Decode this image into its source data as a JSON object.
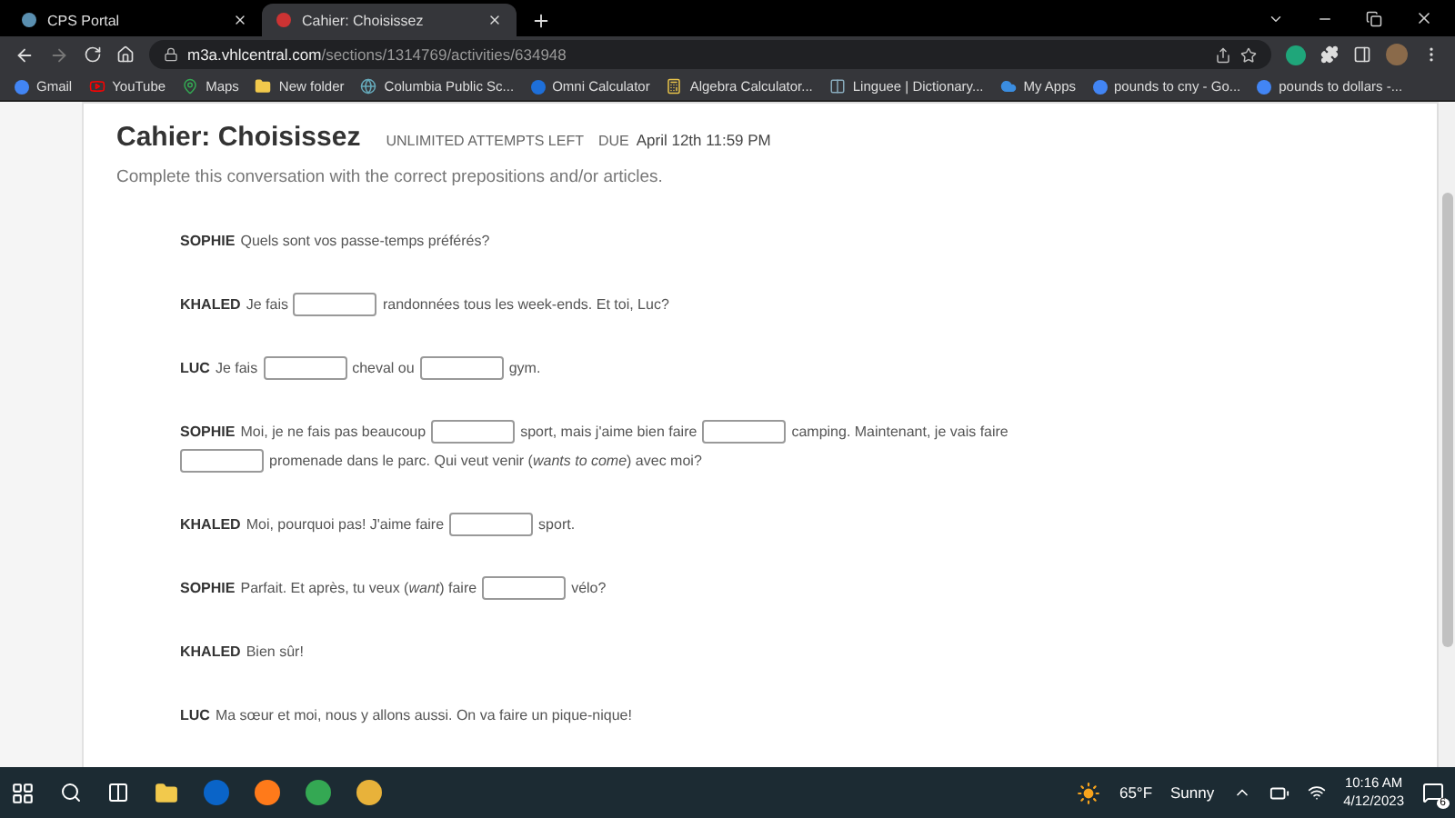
{
  "browser": {
    "tabs": [
      {
        "title": "CPS Portal",
        "selected": false
      },
      {
        "title": "Cahier: Choisissez",
        "selected": true
      }
    ],
    "url": {
      "host": "m3a.vhlcentral.com",
      "path": "/sections/1314769/activities/634948"
    },
    "bookmarks": [
      {
        "label": "Gmail",
        "kind": "google"
      },
      {
        "label": "YouTube",
        "kind": "youtube"
      },
      {
        "label": "Maps",
        "kind": "maps"
      },
      {
        "label": "New folder",
        "kind": "folder"
      },
      {
        "label": "Columbia Public Sc...",
        "kind": "globe"
      },
      {
        "label": "Omni Calculator",
        "kind": "omni"
      },
      {
        "label": "Algebra Calculator...",
        "kind": "calc"
      },
      {
        "label": "Linguee | Dictionary...",
        "kind": "linguee"
      },
      {
        "label": "My Apps",
        "kind": "cloud"
      },
      {
        "label": "pounds to cny - Go...",
        "kind": "google"
      },
      {
        "label": "pounds to dollars -...",
        "kind": "google"
      }
    ]
  },
  "activity": {
    "title": "Cahier: Choisissez",
    "attempts": "UNLIMITED ATTEMPTS LEFT",
    "due_label": "DUE",
    "due": "April 12th 11:59 PM",
    "instructions": "Complete this conversation with the correct prepositions and/or articles.",
    "lines": [
      {
        "speaker": "SOPHIE",
        "parts": [
          {
            "kind": "text",
            "text": "Quels sont vos passe-temps préférés?"
          }
        ]
      },
      {
        "speaker": "KHALED",
        "parts": [
          {
            "kind": "text",
            "text": "Je fais"
          },
          {
            "kind": "blank"
          },
          {
            "kind": "text",
            "text": "randonnées tous les week-ends. Et toi, Luc?"
          }
        ]
      },
      {
        "speaker": "LUC",
        "parts": [
          {
            "kind": "text",
            "text": "Je fais"
          },
          {
            "kind": "blank"
          },
          {
            "kind": "text",
            "text": "cheval ou"
          },
          {
            "kind": "blank"
          },
          {
            "kind": "text",
            "text": "gym."
          }
        ]
      },
      {
        "speaker": "SOPHIE",
        "parts": [
          {
            "kind": "text",
            "text": "Moi, je ne fais pas beaucoup"
          },
          {
            "kind": "blank"
          },
          {
            "kind": "text",
            "text": "sport, mais j'aime bien faire"
          },
          {
            "kind": "blank"
          },
          {
            "kind": "text",
            "text": "camping. Maintenant, je vais faire"
          },
          {
            "kind": "blank"
          },
          {
            "kind": "text",
            "text": "promenade dans le parc. Qui veut venir (*wants to come*) avec moi?"
          }
        ]
      },
      {
        "speaker": "KHALED",
        "parts": [
          {
            "kind": "text",
            "text": "Moi, pourquoi pas! J'aime faire"
          },
          {
            "kind": "blank"
          },
          {
            "kind": "text",
            "text": "sport."
          }
        ]
      },
      {
        "speaker": "SOPHIE",
        "parts": [
          {
            "kind": "text",
            "text": "Parfait. Et après, tu veux (*want*) faire"
          },
          {
            "kind": "blank"
          },
          {
            "kind": "text",
            "text": "vélo?"
          }
        ]
      },
      {
        "speaker": "KHALED",
        "parts": [
          {
            "kind": "text",
            "text": "Bien sûr!"
          }
        ]
      },
      {
        "speaker": "LUC",
        "parts": [
          {
            "kind": "text",
            "text": "Ma sœur et moi, nous y allons aussi. On va faire un pique-nique!"
          }
        ]
      }
    ]
  },
  "taskbar": {
    "weather": {
      "temperature": "65°F",
      "condition": "Sunny"
    },
    "time": "10:16 AM",
    "date": "4/12/2023",
    "notifications": "6"
  }
}
